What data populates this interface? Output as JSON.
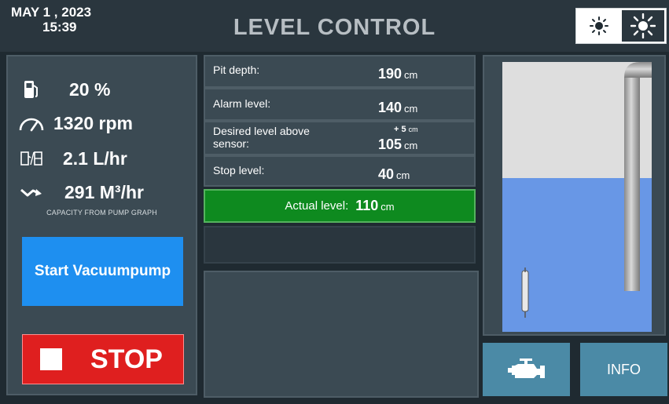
{
  "header": {
    "date": "MAY   1 , 2023",
    "time": "15:39",
    "title": "LEVEL CONTROL",
    "brightness_low_icon": "sun-small-icon",
    "brightness_high_icon": "sun-large-icon"
  },
  "stats": {
    "fuel_level": "20 %",
    "speed": "1320 rpm",
    "fuel_rate": "2.1 L/hr",
    "capacity": "291 M³/hr",
    "capacity_note": "CAPACITY FROM PUMP GRAPH"
  },
  "buttons": {
    "start": "Start Vacuumpump",
    "stop": "STOP",
    "info": "INFO",
    "engine_icon": "engine-icon"
  },
  "levels": {
    "pit_depth": {
      "label": "Pit depth:",
      "value": "190",
      "unit": "cm"
    },
    "alarm_level": {
      "label": "Alarm level:",
      "value": "140",
      "unit": "cm"
    },
    "desired_level": {
      "label": "Desired level above sensor:",
      "offset": "+ 5",
      "offset_unit": "cm",
      "value": "105",
      "unit": "cm"
    },
    "stop_level": {
      "label": "Stop level:",
      "value": "40",
      "unit": "cm"
    },
    "actual_level": {
      "label": "Actual level:",
      "value": "110",
      "unit": "cm"
    }
  },
  "tank": {
    "water_fraction": 0.57
  },
  "colors": {
    "background": "#1f2a31",
    "panel": "#3b4a53",
    "start_button": "#1e8ff0",
    "stop_button": "#df1f1f",
    "actual_level_ok": "#0e8a1f",
    "water": "#6897e6",
    "tank_air": "#dedede",
    "bottom_buttons": "#4b8aa6"
  }
}
